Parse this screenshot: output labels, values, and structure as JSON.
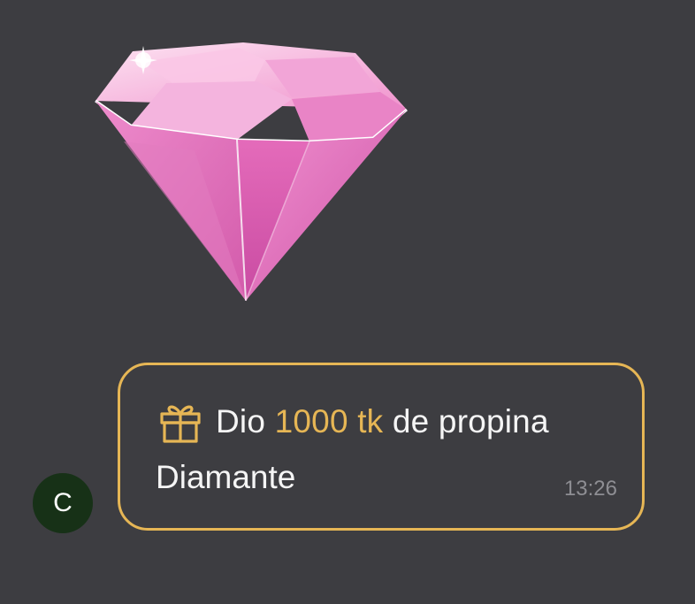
{
  "sticker": {
    "icon": "pink-diamond-icon",
    "colors": {
      "light": "#f6b7dc",
      "mid": "#ec7cc4",
      "dark": "#c84fa3"
    }
  },
  "avatar": {
    "initial": "C",
    "color": "#173117"
  },
  "message": {
    "prefix": "Dio",
    "amount": "1000 tk",
    "suffix": "de propina",
    "gift_name": "Diamante",
    "time": "13:26",
    "accent_color": "#e6b655",
    "icon": "gift-icon"
  }
}
